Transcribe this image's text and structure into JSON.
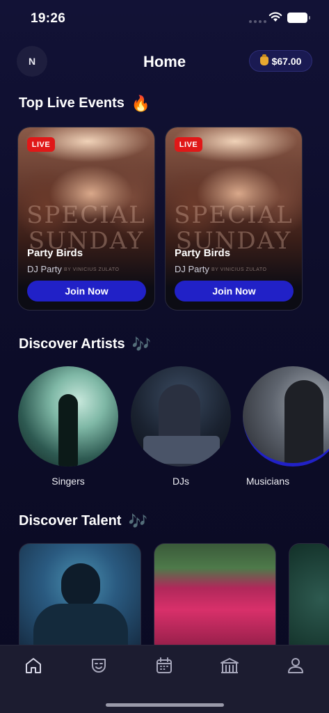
{
  "status_bar": {
    "time": "19:26"
  },
  "header": {
    "avatar_initial": "N",
    "title": "Home",
    "balance": "$67.00",
    "balance_icon": "money-bag-icon"
  },
  "sections": {
    "live_events": {
      "title": "Top Live Events",
      "emoji": "🔥"
    },
    "artists": {
      "title": "Discover Artists",
      "emoji": "🎶"
    },
    "talent": {
      "title": "Discover Talent",
      "emoji": "🎶"
    }
  },
  "events": [
    {
      "badge": "LIVE",
      "name": "Party Birds",
      "category": "DJ Party",
      "poster_text": "SPECIAL SUNDAY",
      "credit": "BY VINICIUS ZULATO",
      "button": "Join Now"
    },
    {
      "badge": "LIVE",
      "name": "Party Birds",
      "category": "DJ Party",
      "poster_text": "SPECIAL SUNDAY",
      "credit": "BY VINICIUS ZULATO",
      "button": "Join Now"
    }
  ],
  "artists": [
    {
      "label": "Singers"
    },
    {
      "label": "DJs"
    },
    {
      "label": "Musicians"
    }
  ],
  "tabs": [
    {
      "name": "home-icon",
      "active": true
    },
    {
      "name": "theater-mask-icon",
      "active": false
    },
    {
      "name": "calendar-icon",
      "active": false
    },
    {
      "name": "venue-icon",
      "active": false
    },
    {
      "name": "profile-icon",
      "active": false
    }
  ],
  "colors": {
    "accent": "#2121c7",
    "live": "#e01818",
    "background": "#0d0d2a",
    "tab_bar": "#1c1c30"
  }
}
